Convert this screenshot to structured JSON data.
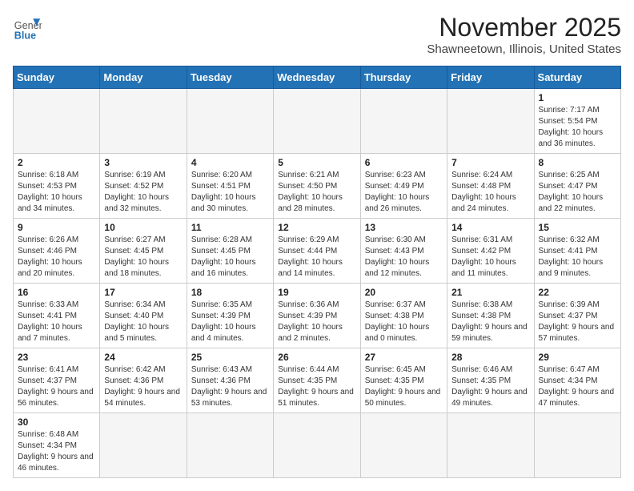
{
  "header": {
    "logo_line1": "General",
    "logo_line2": "Blue",
    "title": "November 2025",
    "subtitle": "Shawneetown, Illinois, United States"
  },
  "weekdays": [
    "Sunday",
    "Monday",
    "Tuesday",
    "Wednesday",
    "Thursday",
    "Friday",
    "Saturday"
  ],
  "weeks": [
    [
      {
        "day": "",
        "info": ""
      },
      {
        "day": "",
        "info": ""
      },
      {
        "day": "",
        "info": ""
      },
      {
        "day": "",
        "info": ""
      },
      {
        "day": "",
        "info": ""
      },
      {
        "day": "",
        "info": ""
      },
      {
        "day": "1",
        "info": "Sunrise: 7:17 AM\nSunset: 5:54 PM\nDaylight: 10 hours and 36 minutes."
      }
    ],
    [
      {
        "day": "2",
        "info": "Sunrise: 6:18 AM\nSunset: 4:53 PM\nDaylight: 10 hours and 34 minutes."
      },
      {
        "day": "3",
        "info": "Sunrise: 6:19 AM\nSunset: 4:52 PM\nDaylight: 10 hours and 32 minutes."
      },
      {
        "day": "4",
        "info": "Sunrise: 6:20 AM\nSunset: 4:51 PM\nDaylight: 10 hours and 30 minutes."
      },
      {
        "day": "5",
        "info": "Sunrise: 6:21 AM\nSunset: 4:50 PM\nDaylight: 10 hours and 28 minutes."
      },
      {
        "day": "6",
        "info": "Sunrise: 6:23 AM\nSunset: 4:49 PM\nDaylight: 10 hours and 26 minutes."
      },
      {
        "day": "7",
        "info": "Sunrise: 6:24 AM\nSunset: 4:48 PM\nDaylight: 10 hours and 24 minutes."
      },
      {
        "day": "8",
        "info": "Sunrise: 6:25 AM\nSunset: 4:47 PM\nDaylight: 10 hours and 22 minutes."
      }
    ],
    [
      {
        "day": "9",
        "info": "Sunrise: 6:26 AM\nSunset: 4:46 PM\nDaylight: 10 hours and 20 minutes."
      },
      {
        "day": "10",
        "info": "Sunrise: 6:27 AM\nSunset: 4:45 PM\nDaylight: 10 hours and 18 minutes."
      },
      {
        "day": "11",
        "info": "Sunrise: 6:28 AM\nSunset: 4:45 PM\nDaylight: 10 hours and 16 minutes."
      },
      {
        "day": "12",
        "info": "Sunrise: 6:29 AM\nSunset: 4:44 PM\nDaylight: 10 hours and 14 minutes."
      },
      {
        "day": "13",
        "info": "Sunrise: 6:30 AM\nSunset: 4:43 PM\nDaylight: 10 hours and 12 minutes."
      },
      {
        "day": "14",
        "info": "Sunrise: 6:31 AM\nSunset: 4:42 PM\nDaylight: 10 hours and 11 minutes."
      },
      {
        "day": "15",
        "info": "Sunrise: 6:32 AM\nSunset: 4:41 PM\nDaylight: 10 hours and 9 minutes."
      }
    ],
    [
      {
        "day": "16",
        "info": "Sunrise: 6:33 AM\nSunset: 4:41 PM\nDaylight: 10 hours and 7 minutes."
      },
      {
        "day": "17",
        "info": "Sunrise: 6:34 AM\nSunset: 4:40 PM\nDaylight: 10 hours and 5 minutes."
      },
      {
        "day": "18",
        "info": "Sunrise: 6:35 AM\nSunset: 4:39 PM\nDaylight: 10 hours and 4 minutes."
      },
      {
        "day": "19",
        "info": "Sunrise: 6:36 AM\nSunset: 4:39 PM\nDaylight: 10 hours and 2 minutes."
      },
      {
        "day": "20",
        "info": "Sunrise: 6:37 AM\nSunset: 4:38 PM\nDaylight: 10 hours and 0 minutes."
      },
      {
        "day": "21",
        "info": "Sunrise: 6:38 AM\nSunset: 4:38 PM\nDaylight: 9 hours and 59 minutes."
      },
      {
        "day": "22",
        "info": "Sunrise: 6:39 AM\nSunset: 4:37 PM\nDaylight: 9 hours and 57 minutes."
      }
    ],
    [
      {
        "day": "23",
        "info": "Sunrise: 6:41 AM\nSunset: 4:37 PM\nDaylight: 9 hours and 56 minutes."
      },
      {
        "day": "24",
        "info": "Sunrise: 6:42 AM\nSunset: 4:36 PM\nDaylight: 9 hours and 54 minutes."
      },
      {
        "day": "25",
        "info": "Sunrise: 6:43 AM\nSunset: 4:36 PM\nDaylight: 9 hours and 53 minutes."
      },
      {
        "day": "26",
        "info": "Sunrise: 6:44 AM\nSunset: 4:35 PM\nDaylight: 9 hours and 51 minutes."
      },
      {
        "day": "27",
        "info": "Sunrise: 6:45 AM\nSunset: 4:35 PM\nDaylight: 9 hours and 50 minutes."
      },
      {
        "day": "28",
        "info": "Sunrise: 6:46 AM\nSunset: 4:35 PM\nDaylight: 9 hours and 49 minutes."
      },
      {
        "day": "29",
        "info": "Sunrise: 6:47 AM\nSunset: 4:34 PM\nDaylight: 9 hours and 47 minutes."
      }
    ],
    [
      {
        "day": "30",
        "info": "Sunrise: 6:48 AM\nSunset: 4:34 PM\nDaylight: 9 hours and 46 minutes."
      },
      {
        "day": "",
        "info": ""
      },
      {
        "day": "",
        "info": ""
      },
      {
        "day": "",
        "info": ""
      },
      {
        "day": "",
        "info": ""
      },
      {
        "day": "",
        "info": ""
      },
      {
        "day": "",
        "info": ""
      }
    ]
  ]
}
